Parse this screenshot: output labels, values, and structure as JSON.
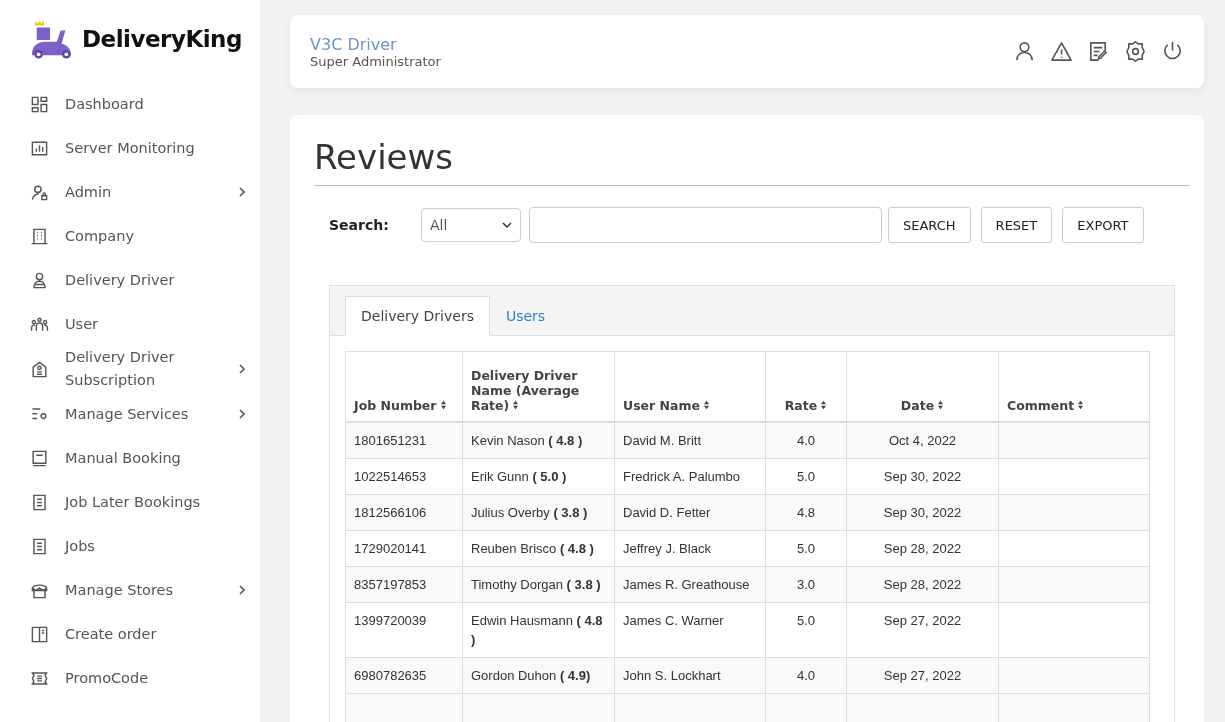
{
  "brand": {
    "name": "DeliveryKing"
  },
  "sidebar": {
    "items": [
      {
        "label": "Dashboard",
        "has_submenu": false
      },
      {
        "label": "Server Monitoring",
        "has_submenu": false
      },
      {
        "label": "Admin",
        "has_submenu": true
      },
      {
        "label": "Company",
        "has_submenu": false
      },
      {
        "label": "Delivery Driver",
        "has_submenu": false
      },
      {
        "label": "User",
        "has_submenu": false
      },
      {
        "label": "Delivery Driver Subscription",
        "has_submenu": true
      },
      {
        "label": "Manage Services",
        "has_submenu": true
      },
      {
        "label": "Manual Booking",
        "has_submenu": false
      },
      {
        "label": "Job Later Bookings",
        "has_submenu": false
      },
      {
        "label": "Jobs",
        "has_submenu": false
      },
      {
        "label": "Manage Stores",
        "has_submenu": true
      },
      {
        "label": "Create order",
        "has_submenu": false
      },
      {
        "label": "PromoCode",
        "has_submenu": false
      }
    ]
  },
  "header": {
    "user_name": "V3C Driver",
    "role": "Super Administrator"
  },
  "page": {
    "title": "Reviews"
  },
  "search": {
    "label": "Search:",
    "filter": "All",
    "buttons": [
      "SEARCH",
      "RESET",
      "EXPORT"
    ]
  },
  "tabs": [
    {
      "label": "Delivery Drivers",
      "selected": true
    },
    {
      "label": "Users",
      "selected": false
    }
  ],
  "table": {
    "columns": [
      {
        "label": "Job Number"
      },
      {
        "label": "Delivery Driver Name (Average Rate)"
      },
      {
        "label": "User Name"
      },
      {
        "label": "Rate"
      },
      {
        "label": "Date"
      },
      {
        "label": "Comment"
      }
    ],
    "rows": [
      [
        "1801651231",
        "Kevin Nason **( 4.8 )**",
        "David M. Britt",
        "4.0",
        "Oct 4, 2022",
        ""
      ],
      [
        "1022514653",
        "Erik Gunn **( 5.0 )**",
        "Fredrick A. Palumbo",
        "5.0",
        "Sep 30, 2022",
        ""
      ],
      [
        "1812566106",
        "Julius Overby **( 3.8 )**",
        "David D. Fetter",
        "4.8",
        "Sep 30, 2022",
        ""
      ],
      [
        "1729020141",
        "Reuben Brisco **( 4.8 )**",
        "Jeffrey J. Black",
        "5.0",
        "Sep 28, 2022",
        ""
      ],
      [
        "8357197853",
        "Timothy Dorgan **( 3.8 )**",
        "James R. Greathouse",
        "3.0",
        "Sep 28, 2022",
        ""
      ],
      [
        "1399720039",
        "Edwin Hausmann **( 4.8 )**",
        "James C. Warner",
        "5.0",
        "Sep 27, 2022",
        ""
      ],
      [
        "6980782635",
        "Gordon Duhon **( 4.9)**",
        "John S. Lockhart",
        "4.0",
        "Sep 27, 2022",
        ""
      ]
    ]
  }
}
